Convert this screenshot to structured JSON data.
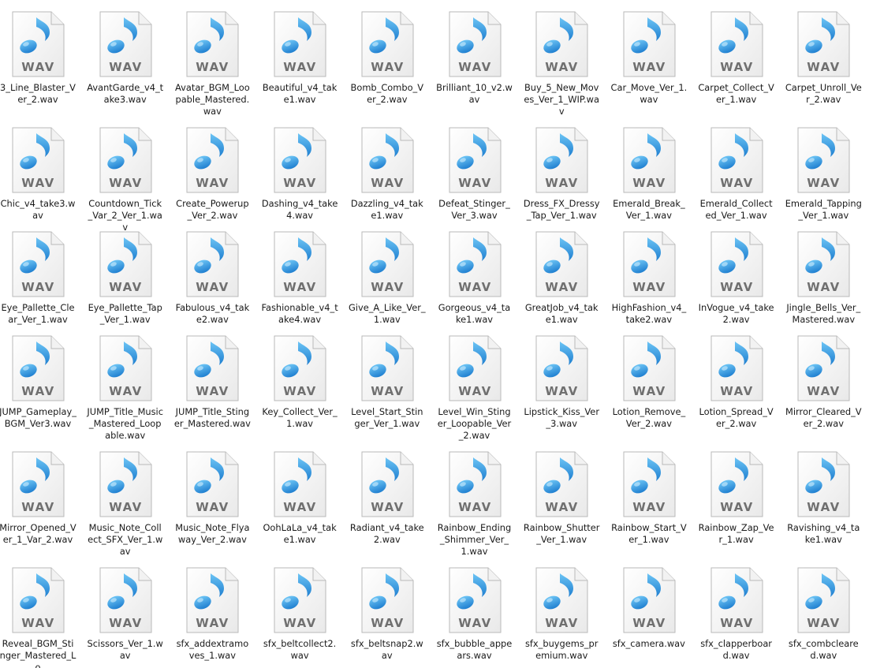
{
  "icon": {
    "name": "wav-audio-file-icon",
    "label": "WAV",
    "note_color": "#2a8fdc",
    "label_color": "#707070"
  },
  "files": [
    {
      "name": "3_Line_Blaster_Ver_2.wav"
    },
    {
      "name": "AvantGarde_v4_take3.wav"
    },
    {
      "name": "Avatar_BGM_Loopable_Mastered.wav"
    },
    {
      "name": "Beautiful_v4_take1.wav"
    },
    {
      "name": "Bomb_Combo_Ver_2.wav"
    },
    {
      "name": "Brilliant_10_v2.wav"
    },
    {
      "name": "Buy_5_New_Moves_Ver_1_WIP.wav"
    },
    {
      "name": "Car_Move_Ver_1.wav"
    },
    {
      "name": "Carpet_Collect_Ver_1.wav"
    },
    {
      "name": "Carpet_Unroll_Ver_2.wav"
    },
    {
      "name": "Chic_v4_take3.wav"
    },
    {
      "name": "Countdown_Tick_Var_2_Ver_1.wav"
    },
    {
      "name": "Create_Powerup_Ver_2.wav"
    },
    {
      "name": "Dashing_v4_take4.wav"
    },
    {
      "name": "Dazzling_v4_take1.wav"
    },
    {
      "name": "Defeat_Stinger_Ver_3.wav"
    },
    {
      "name": "Dress_FX_Dressy_Tap_Ver_1.wav"
    },
    {
      "name": "Emerald_Break_Ver_1.wav"
    },
    {
      "name": "Emerald_Collected_Ver_1.wav"
    },
    {
      "name": "Emerald_Tapping_Ver_1.wav"
    },
    {
      "name": "Eye_Pallette_Clear_Ver_1.wav"
    },
    {
      "name": "Eye_Pallette_Tap_Ver_1.wav"
    },
    {
      "name": "Fabulous_v4_take2.wav"
    },
    {
      "name": "Fashionable_v4_take4.wav"
    },
    {
      "name": "Give_A_Like_Ver_1.wav"
    },
    {
      "name": "Gorgeous_v4_take1.wav"
    },
    {
      "name": "GreatJob_v4_take1.wav"
    },
    {
      "name": "HighFashion_v4_take2.wav"
    },
    {
      "name": "InVogue_v4_take2.wav"
    },
    {
      "name": "Jingle_Bells_Ver_Mastered.wav"
    },
    {
      "name": "JUMP_Gameplay_BGM_Ver3.wav"
    },
    {
      "name": "JUMP_Title_Music_Mastered_Loopable.wav"
    },
    {
      "name": "JUMP_Title_Stinger_Mastered.wav"
    },
    {
      "name": "Key_Collect_Ver_1.wav"
    },
    {
      "name": "Level_Start_Stinger_Ver_1.wav"
    },
    {
      "name": "Level_Win_Stinger_Loopable_Ver_2.wav"
    },
    {
      "name": "Lipstick_Kiss_Ver_3.wav"
    },
    {
      "name": "Lotion_Remove_Ver_2.wav"
    },
    {
      "name": "Lotion_Spread_Ver_2.wav"
    },
    {
      "name": "Mirror_Cleared_Ver_2.wav"
    },
    {
      "name": "Mirror_Opened_Ver_1_Var_2.wav"
    },
    {
      "name": "Music_Note_Collect_SFX_Ver_1.wav"
    },
    {
      "name": "Music_Note_Flyaway_Ver_2.wav"
    },
    {
      "name": "OohLaLa_v4_take1.wav"
    },
    {
      "name": "Radiant_v4_take2.wav"
    },
    {
      "name": "Rainbow_Ending_Shimmer_Ver_1.wav"
    },
    {
      "name": "Rainbow_Shutter_Ver_1.wav"
    },
    {
      "name": "Rainbow_Start_Ver_1.wav"
    },
    {
      "name": "Rainbow_Zap_Ver_1.wav"
    },
    {
      "name": "Ravishing_v4_take1.wav"
    },
    {
      "name": "Reveal_BGM_Stinger_Mastered_Lo"
    },
    {
      "name": "Scissors_Ver_1.wav"
    },
    {
      "name": "sfx_addextramoves_1.wav"
    },
    {
      "name": "sfx_beltcollect2.wav"
    },
    {
      "name": "sfx_beltsnap2.wav"
    },
    {
      "name": "sfx_bubble_appears.wav"
    },
    {
      "name": "sfx_buygems_premium.wav"
    },
    {
      "name": "sfx_camera.wav"
    },
    {
      "name": "sfx_clapperboard.wav"
    },
    {
      "name": "sfx_combcleared.wav"
    }
  ]
}
